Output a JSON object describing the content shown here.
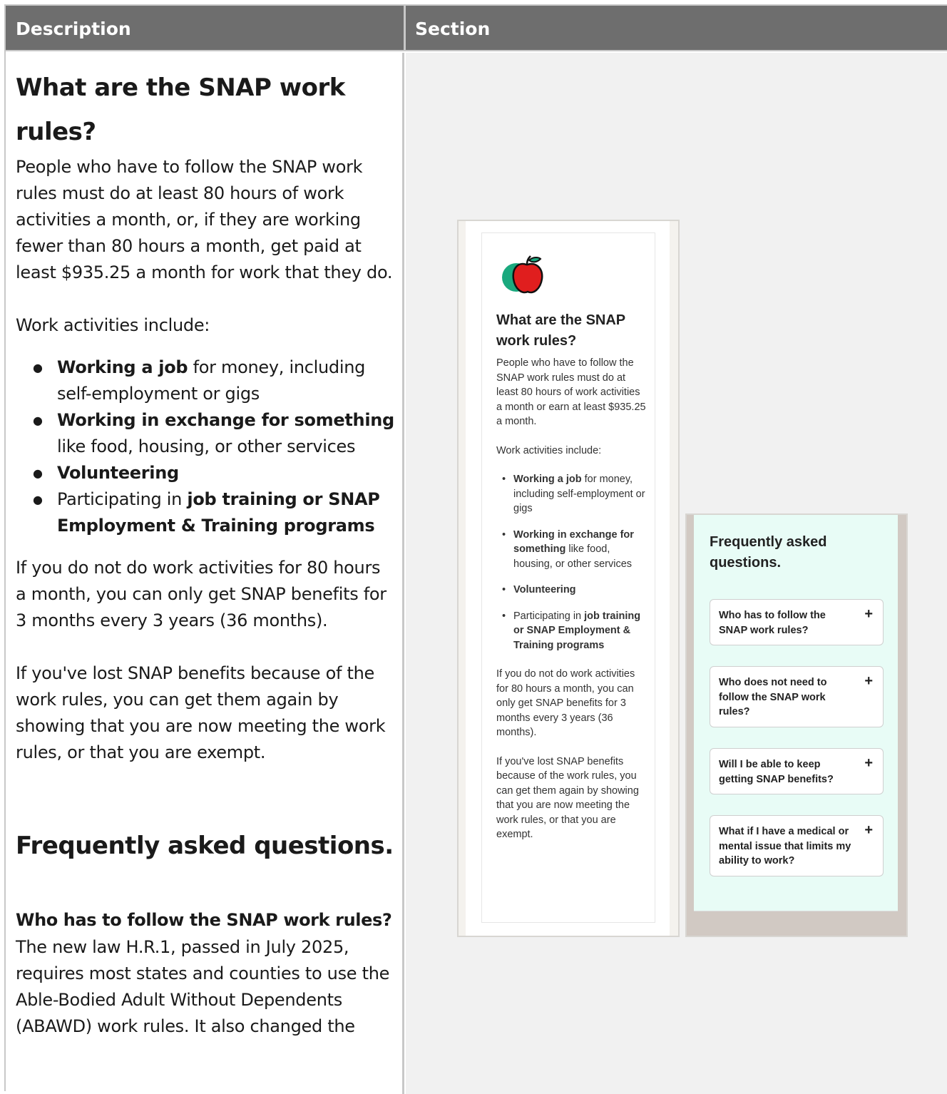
{
  "table": {
    "header_description": "Description",
    "header_section": "Section"
  },
  "description": {
    "title": "What are the SNAP work rules?",
    "intro": "People who have to follow the SNAP work rules must do at least 80 hours of work activities a month, or, if they are working fewer than 80 hours a month, get paid at least $935.25 a month for work that they do.",
    "activities_label": "Work activities include:",
    "activities": [
      {
        "bold_pre": "",
        "bold": "Working a job",
        "rest": " for money, including self-employment or gigs"
      },
      {
        "bold_pre": "",
        "bold": "Working in exchange for something",
        "rest": " like food, housing, or other services"
      },
      {
        "bold_pre": "",
        "bold": "Volunteering",
        "rest": ""
      },
      {
        "bold_pre": "Participating in ",
        "bold": "job training or SNAP Employment & Training programs",
        "rest": ""
      }
    ],
    "limit_text": "If you do not do work activities for 80 hours a month, you can only get SNAP benefits for 3 months every 3 years (36 months).",
    "lost_text": "If you've lost SNAP benefits because of the work rules, you can get them again by showing that you are now meeting the work rules, or that you are exempt.",
    "faq_heading": "Frequently asked questions.",
    "faq_q1": "Who has to follow the SNAP work rules?",
    "faq_a1": "The new law H.R.1, passed in July 2025, requires most states and counties to use the Able-Bodied Adult Without Dependents (ABAWD) work rules. It also changed the"
  },
  "mock_card": {
    "apple_icon": "apple-icon",
    "title": "What are the SNAP work rules?",
    "intro": "People who have to follow the SNAP work rules must do at least 80 hours of work activities a month or earn at least $935.25 a month.",
    "activities_label": "Work activities include:",
    "item1_bold": "Working a job",
    "item1_rest": " for money, including self-employment or gigs",
    "item2_bold": "Working in exchange for something",
    "item2_rest": " like food, housing, or other services",
    "item3_bold": "Volunteering",
    "item4_pre": "Participating in ",
    "item4_bold": "job training or SNAP Employment & Training programs",
    "limit_text": "If you do not do work activities for 80 hours a month, you can only get SNAP benefits for 3 months every 3 years (36 months).",
    "lost_text": "If you've lost SNAP benefits because of the work rules, you can get them again by showing that you are now meeting the work rules, or that you are exempt."
  },
  "mock_faq": {
    "title": "Frequently asked questions.",
    "items": [
      "Who has to follow the SNAP work rules?",
      "Who does not need to follow the SNAP work rules?",
      "Will I be able to keep getting SNAP benefits?",
      "What if I have a medical or mental issue that limits my ability to work?"
    ],
    "expand_symbol": "+"
  },
  "colors": {
    "header_bg": "#6e6e6e",
    "section_bg": "#f1f1f1",
    "faq_bg": "#e8fcf6",
    "apple_red": "#e01e1e",
    "apple_green": "#1aa97e"
  }
}
